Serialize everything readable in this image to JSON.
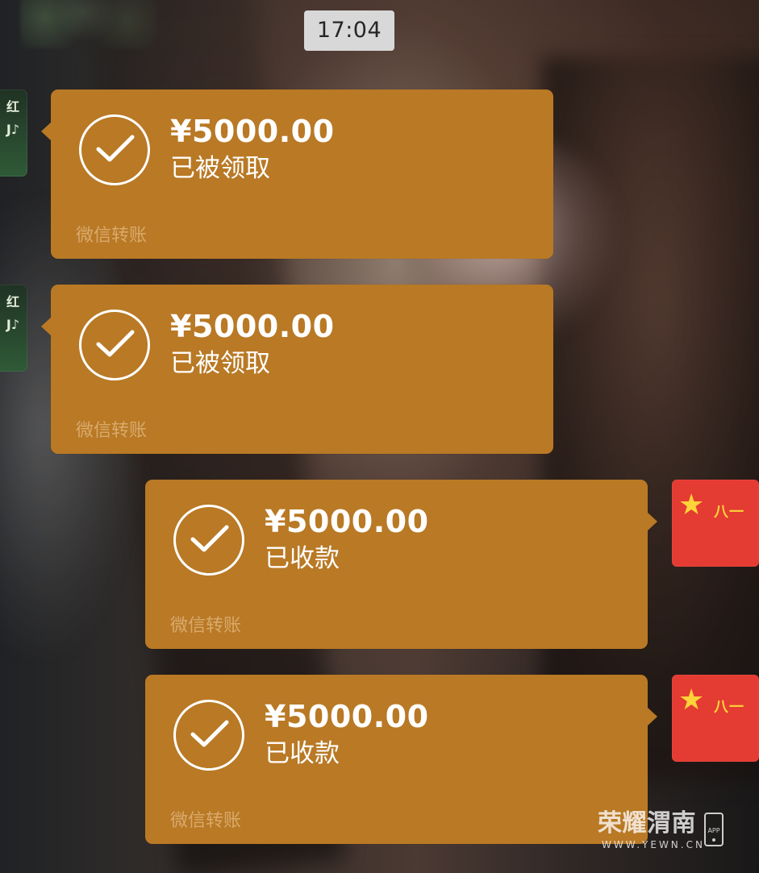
{
  "chat": {
    "time": "17:04",
    "left_avatar_label": "红J♪",
    "right_avatar": {
      "star": "★",
      "label": "八一"
    },
    "messages": [
      {
        "amount": "¥5000.00",
        "status": "已被领取",
        "footer": "微信转账"
      },
      {
        "amount": "¥5000.00",
        "status": "已被领取",
        "footer": "微信转账"
      },
      {
        "amount": "¥5000.00",
        "status": "已收款",
        "footer": "微信转账"
      },
      {
        "amount": "¥5000.00",
        "status": "已收款",
        "footer": "微信转账"
      }
    ]
  },
  "watermark": {
    "title": "荣耀渭南",
    "url": "WWW.YEWN.CN",
    "app_label": "APP"
  },
  "colors": {
    "transfer_bubble": "#b97925",
    "secondary_text": "#d9aa6d",
    "time_chip": "#d8d8d8",
    "red_avatar": "#e43b32",
    "star_yellow": "#ffd339"
  }
}
